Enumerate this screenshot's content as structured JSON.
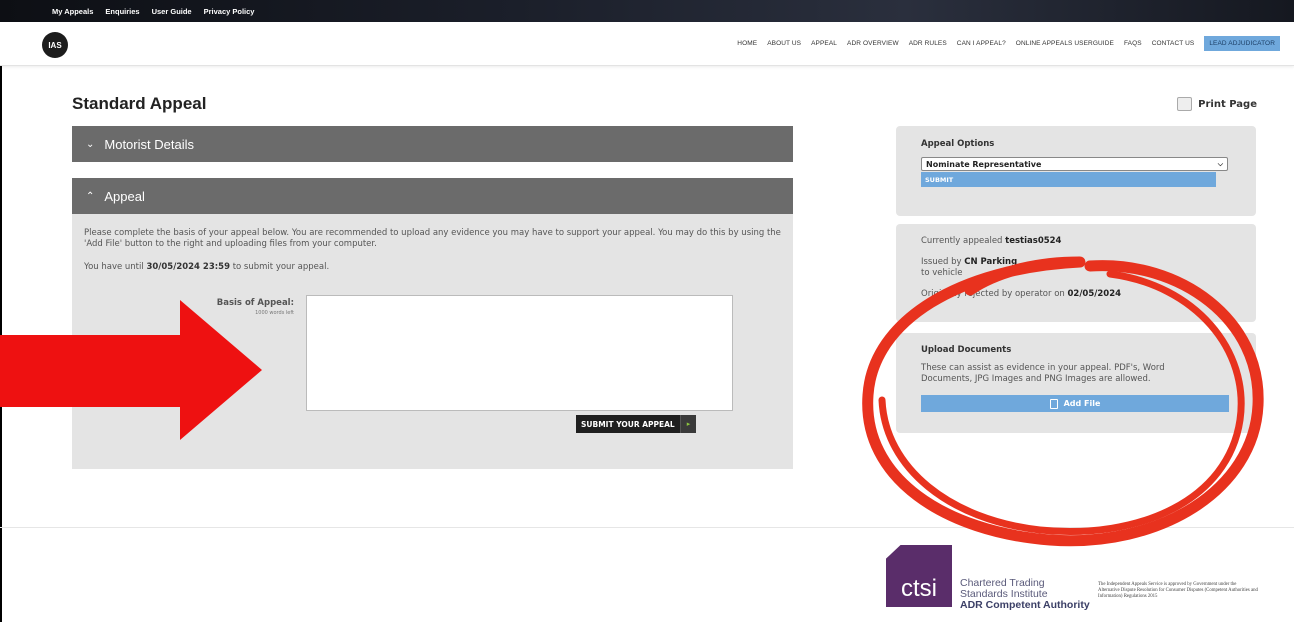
{
  "topbar": {
    "links": [
      "My Appeals",
      "Enquiries",
      "User Guide",
      "Privacy Policy"
    ]
  },
  "header": {
    "logo": "IAS",
    "nav": [
      "HOME",
      "ABOUT US",
      "APPEAL",
      "ADR OVERVIEW",
      "ADR RULES",
      "CAN I APPEAL?",
      "ONLINE APPEALS USERGUIDE",
      "FAQS",
      "CONTACT US",
      "LEAD ADJUDICATOR"
    ]
  },
  "page": {
    "title": "Standard Appeal",
    "print_label": "Print Page"
  },
  "sections": {
    "motorist": {
      "title": "Motorist Details",
      "chevron": "⌄"
    },
    "appeal": {
      "title": "Appeal",
      "chevron": "⌃"
    }
  },
  "appeal_form": {
    "intro": "Please complete the basis of your appeal below. You are recommended to upload any evidence you may have to support your appeal. You may do this by using the 'Add File' button to the right and uploading files from your computer.",
    "deadline_prefix": "You have until ",
    "deadline": "30/05/2024 23:59",
    "deadline_suffix": " to submit your appeal.",
    "basis_label": "Basis of Appeal:",
    "words_left": "1000 words left",
    "textarea_value": "",
    "submit_label": "SUBMIT YOUR APPEAL",
    "submit_arrow": "▸"
  },
  "appeal_options": {
    "title": "Appeal Options",
    "selected": "Nominate Representative",
    "submit_label": "SUBMIT"
  },
  "status": {
    "appealed_prefix": "Currently appealed ",
    "appealed_ref": "testias0524",
    "issued_prefix": "Issued by ",
    "issuer": "CN Parking",
    "vehicle_prefix": "to vehicle ",
    "rejected_prefix": "Originally rejected by operator on ",
    "rejected_date": "02/05/2024"
  },
  "upload": {
    "title": "Upload Documents",
    "description": "These can assist as evidence in your appeal. PDF's, Word Documents, JPG Images and PNG Images are allowed.",
    "add_file_label": "Add File"
  },
  "footer": {
    "ctsi_logo": "ctsi",
    "ctsi_line1": "Chartered Trading",
    "ctsi_line2": "Standards Institute",
    "ctsi_line3": "ADR Competent Authority",
    "legal": "The Independent Appeals Service is approved by Government under the Alternative Dispute Resolution for Consumer Disputes (Competent Authorities and Information) Regulations 2015"
  },
  "colors": {
    "accent": "#6fa8dc",
    "section_header": "#6b6b6b",
    "annotation_red": "#e8321e",
    "arrow_red": "#ee1111"
  }
}
